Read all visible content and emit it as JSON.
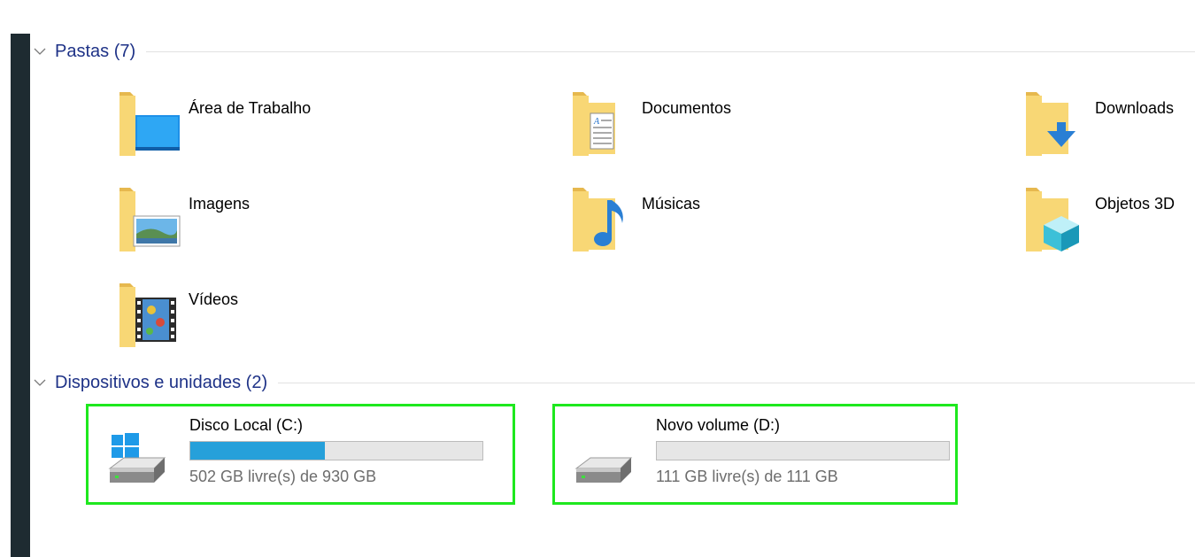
{
  "groups": {
    "folders": {
      "title": "Pastas (7)"
    },
    "devices": {
      "title": "Dispositivos e unidades (2)"
    }
  },
  "folders": [
    {
      "name": "Área de Trabalho",
      "icon": "desktop-folder-icon"
    },
    {
      "name": "Documentos",
      "icon": "documents-folder-icon"
    },
    {
      "name": "Downloads",
      "icon": "downloads-folder-icon"
    },
    {
      "name": "Imagens",
      "icon": "pictures-folder-icon"
    },
    {
      "name": "Músicas",
      "icon": "music-folder-icon"
    },
    {
      "name": "Objetos 3D",
      "icon": "3d-objects-folder-icon"
    },
    {
      "name": "Vídeos",
      "icon": "videos-folder-icon"
    }
  ],
  "drives": [
    {
      "name": "Disco Local (C:)",
      "free": "502 GB livre(s) de 930 GB",
      "used_fraction": 0.46,
      "icon": "windows-drive-icon"
    },
    {
      "name": "Novo volume (D:)",
      "free": "111 GB livre(s) de 111 GB",
      "used_fraction": 0.0,
      "icon": "hard-drive-icon"
    }
  ],
  "colors": {
    "header_text": "#1e3287",
    "selection_highlight": "#1ee81e",
    "usage_bar_fill": "#26a0da",
    "usage_bar_bg": "#e6e6e6",
    "folder_yellow": "#f8d775",
    "sidebar_dark": "#1e2b31"
  }
}
